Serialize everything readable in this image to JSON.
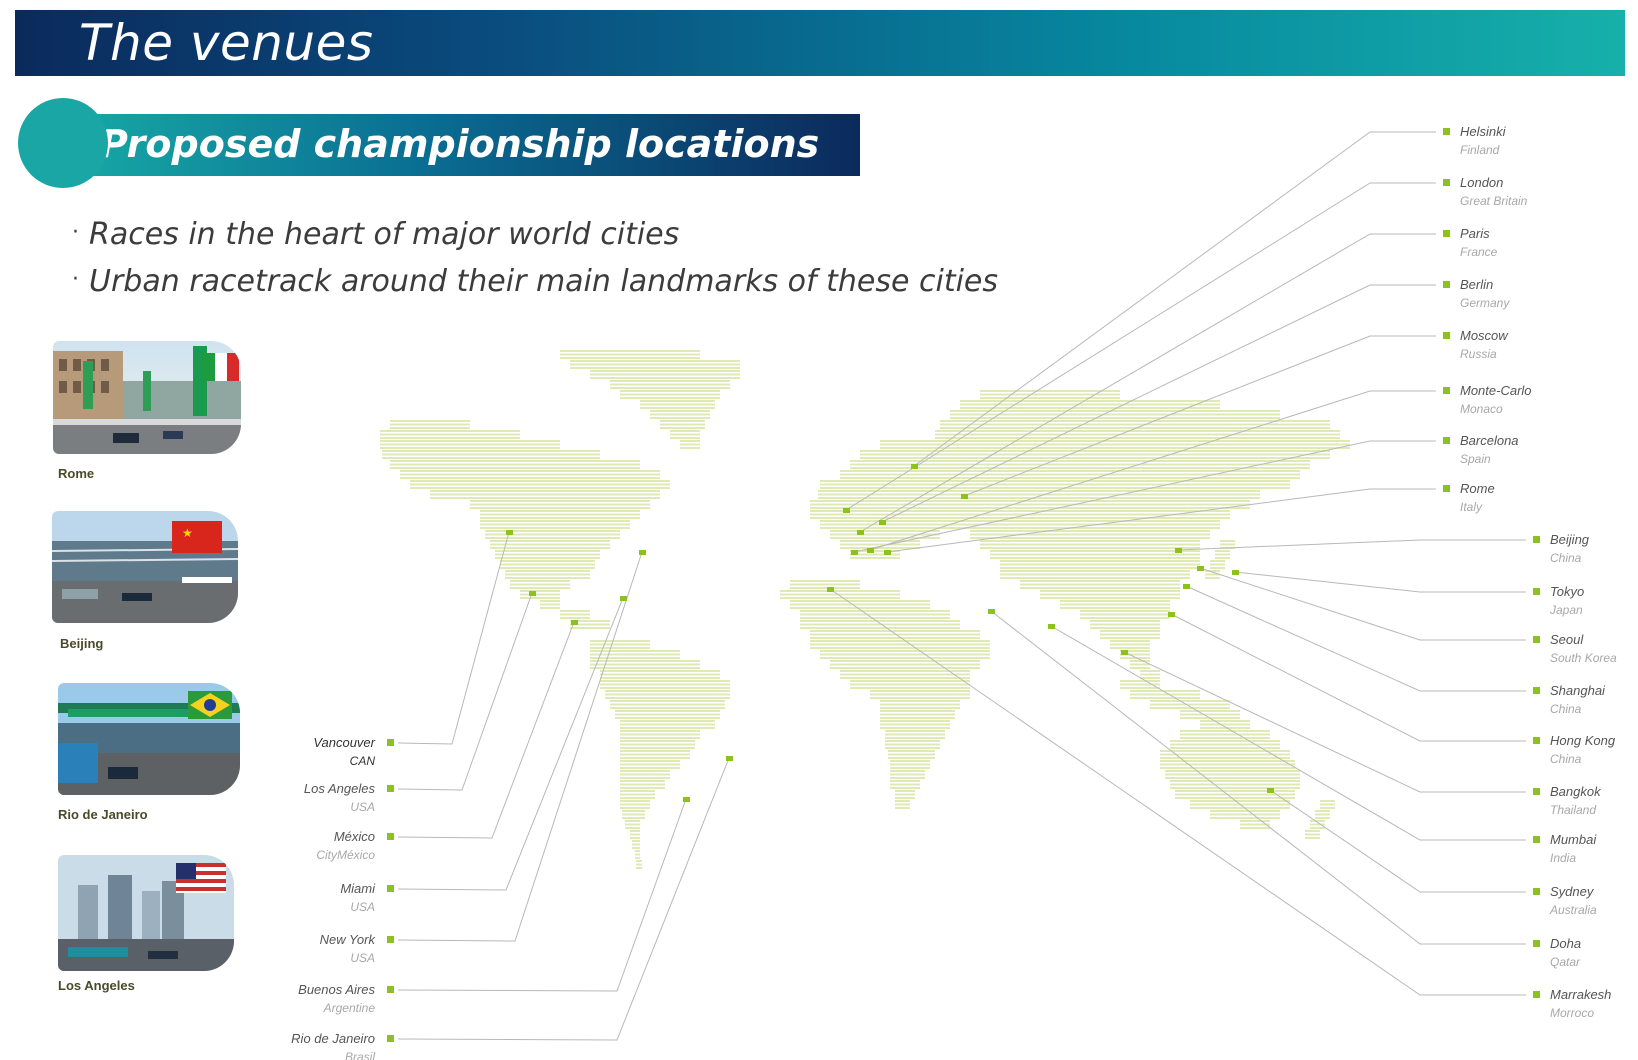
{
  "header": {
    "title": "The venues"
  },
  "section": {
    "title": "Proposed championship locations"
  },
  "bullets": [
    "Races in the heart of major world cities",
    "Urban racetrack around their main landmarks of these cities"
  ],
  "photos": [
    {
      "label": "Rome"
    },
    {
      "label": "Beijing"
    },
    {
      "label": "Rio de Janeiro"
    },
    {
      "label": "Los Angeles"
    }
  ],
  "colors": {
    "marker": "#8cc21f",
    "land": "#dfe9b4",
    "leader_line": "#b8b8b8",
    "city_text": "#555555",
    "country_text": "#a8a8a8"
  },
  "cities_left": [
    {
      "city": "Vancouver",
      "country": "CAN",
      "country_style": "dark"
    },
    {
      "city": "Los Angeles",
      "country": "USA"
    },
    {
      "city": "México",
      "country": "CityMéxico"
    },
    {
      "city": "Miami",
      "country": "USA"
    },
    {
      "city": "New York",
      "country": "USA"
    },
    {
      "city": "Buenos Aires",
      "country": "Argentine"
    },
    {
      "city": "Rio de Janeiro",
      "country": "Brasil"
    }
  ],
  "cities_right_a": [
    {
      "city": "Helsinki",
      "country": "Finland"
    },
    {
      "city": "London",
      "country": "Great Britain"
    },
    {
      "city": "Paris",
      "country": "France"
    },
    {
      "city": "Berlin",
      "country": "Germany"
    },
    {
      "city": "Moscow",
      "country": "Russia"
    },
    {
      "city": "Monte-Carlo",
      "country": "Monaco"
    },
    {
      "city": "Barcelona",
      "country": "Spain"
    },
    {
      "city": "Rome",
      "country": "Italy"
    }
  ],
  "cities_right_b": [
    {
      "city": "Beijing",
      "country": "China"
    },
    {
      "city": "Tokyo",
      "country": "Japan"
    },
    {
      "city": "Seoul",
      "country": "South Korea"
    },
    {
      "city": "Shanghai",
      "country": "China"
    },
    {
      "city": "Hong Kong",
      "country": "China"
    },
    {
      "city": "Bangkok",
      "country": "Thailand"
    },
    {
      "city": "Mumbai",
      "country": "India"
    },
    {
      "city": "Sydney",
      "country": "Australia"
    },
    {
      "city": "Doha",
      "country": "Qatar"
    },
    {
      "city": "Marrakesh",
      "country": "Morroco"
    }
  ]
}
